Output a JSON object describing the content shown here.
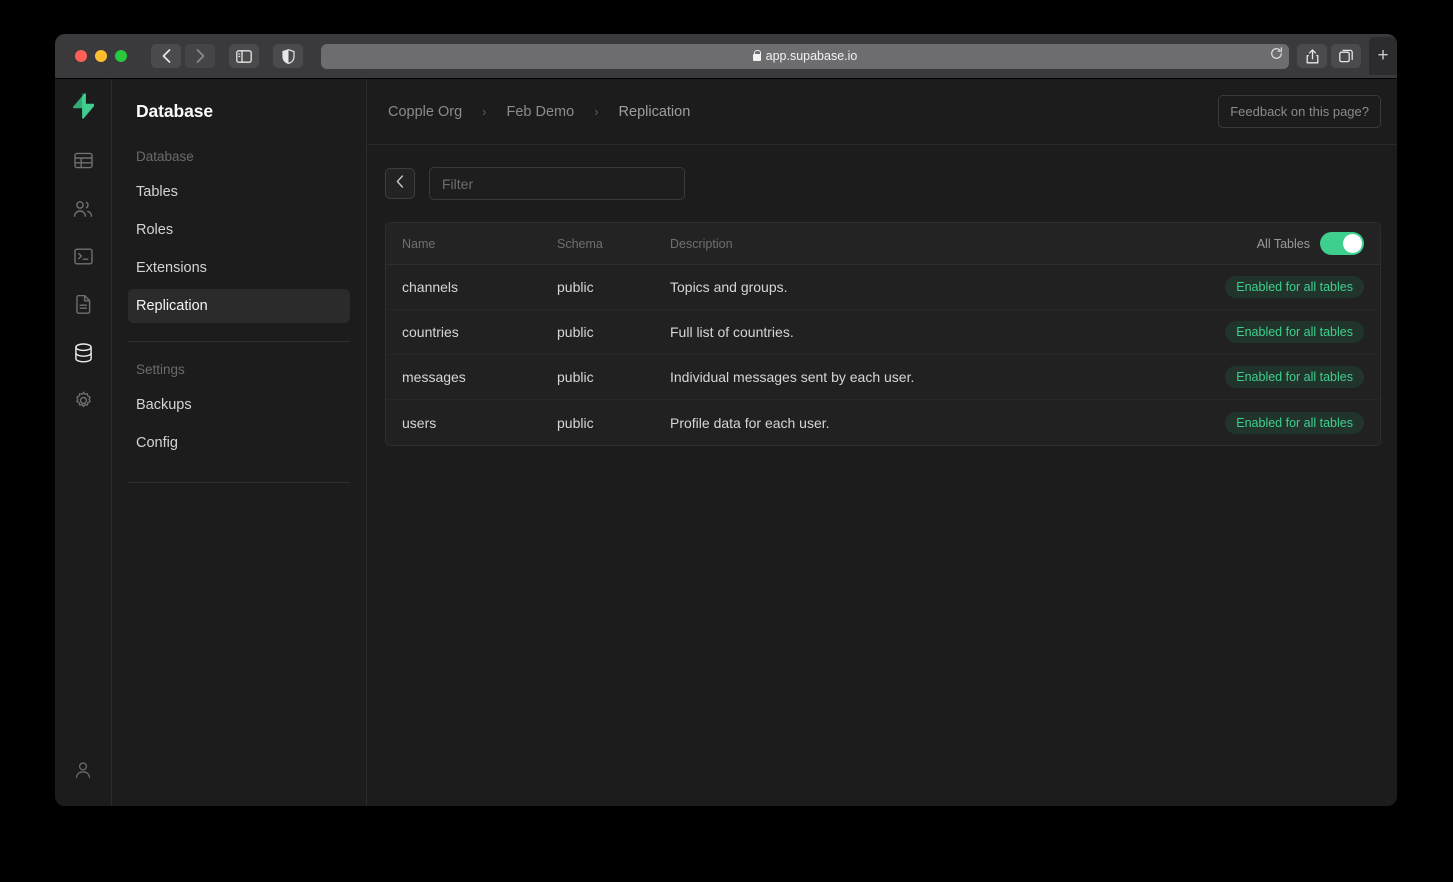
{
  "browser": {
    "url": "app.supabase.io",
    "back_icon": "chevron-left-icon",
    "forward_icon": "chevron-right-icon",
    "sidebar_icon": "sidebar-toggle-icon",
    "privacy_icon": "shield-icon",
    "reload_icon": "reload-icon",
    "share_icon": "share-icon",
    "tabs_icon": "tab-overview-icon",
    "new_tab_label": "+"
  },
  "rail": {
    "logo_name": "supabase-logo",
    "icons": [
      {
        "name": "table-editor-icon",
        "active": false
      },
      {
        "name": "authentication-users-icon",
        "active": false
      },
      {
        "name": "sql-editor-icon",
        "active": false
      },
      {
        "name": "docs-file-icon",
        "active": false
      },
      {
        "name": "database-icon",
        "active": true
      },
      {
        "name": "settings-gear-icon",
        "active": false
      }
    ],
    "bottom_icon": "user-profile-icon"
  },
  "sidebar": {
    "title": "Database",
    "groups": [
      {
        "label": "Database",
        "items": [
          {
            "label": "Tables",
            "active": false
          },
          {
            "label": "Roles",
            "active": false
          },
          {
            "label": "Extensions",
            "active": false
          },
          {
            "label": "Replication",
            "active": true
          }
        ]
      },
      {
        "label": "Settings",
        "items": [
          {
            "label": "Backups",
            "active": false
          },
          {
            "label": "Config",
            "active": false
          }
        ]
      }
    ]
  },
  "topbar": {
    "breadcrumb": [
      {
        "label": "Copple Org"
      },
      {
        "label": "Feb Demo"
      },
      {
        "label": "Replication"
      }
    ],
    "separator": "›",
    "feedback_label": "Feedback on this page?"
  },
  "toolbar": {
    "back_icon": "chevron-left-icon",
    "filter_placeholder": "Filter",
    "filter_value": ""
  },
  "table": {
    "columns": [
      "Name",
      "Schema",
      "Description"
    ],
    "toggle": {
      "label": "All Tables",
      "on": true,
      "on_color": "#3ecf8e"
    },
    "rows": [
      {
        "name": "channels",
        "schema": "public",
        "description": "Topics and groups.",
        "status": "Enabled for all tables"
      },
      {
        "name": "countries",
        "schema": "public",
        "description": "Full list of countries.",
        "status": "Enabled for all tables"
      },
      {
        "name": "messages",
        "schema": "public",
        "description": "Individual messages sent by each user.",
        "status": "Enabled for all tables"
      },
      {
        "name": "users",
        "schema": "public",
        "description": "Profile data for each user.",
        "status": "Enabled for all tables"
      }
    ],
    "status_color": "#3ecf8e"
  }
}
